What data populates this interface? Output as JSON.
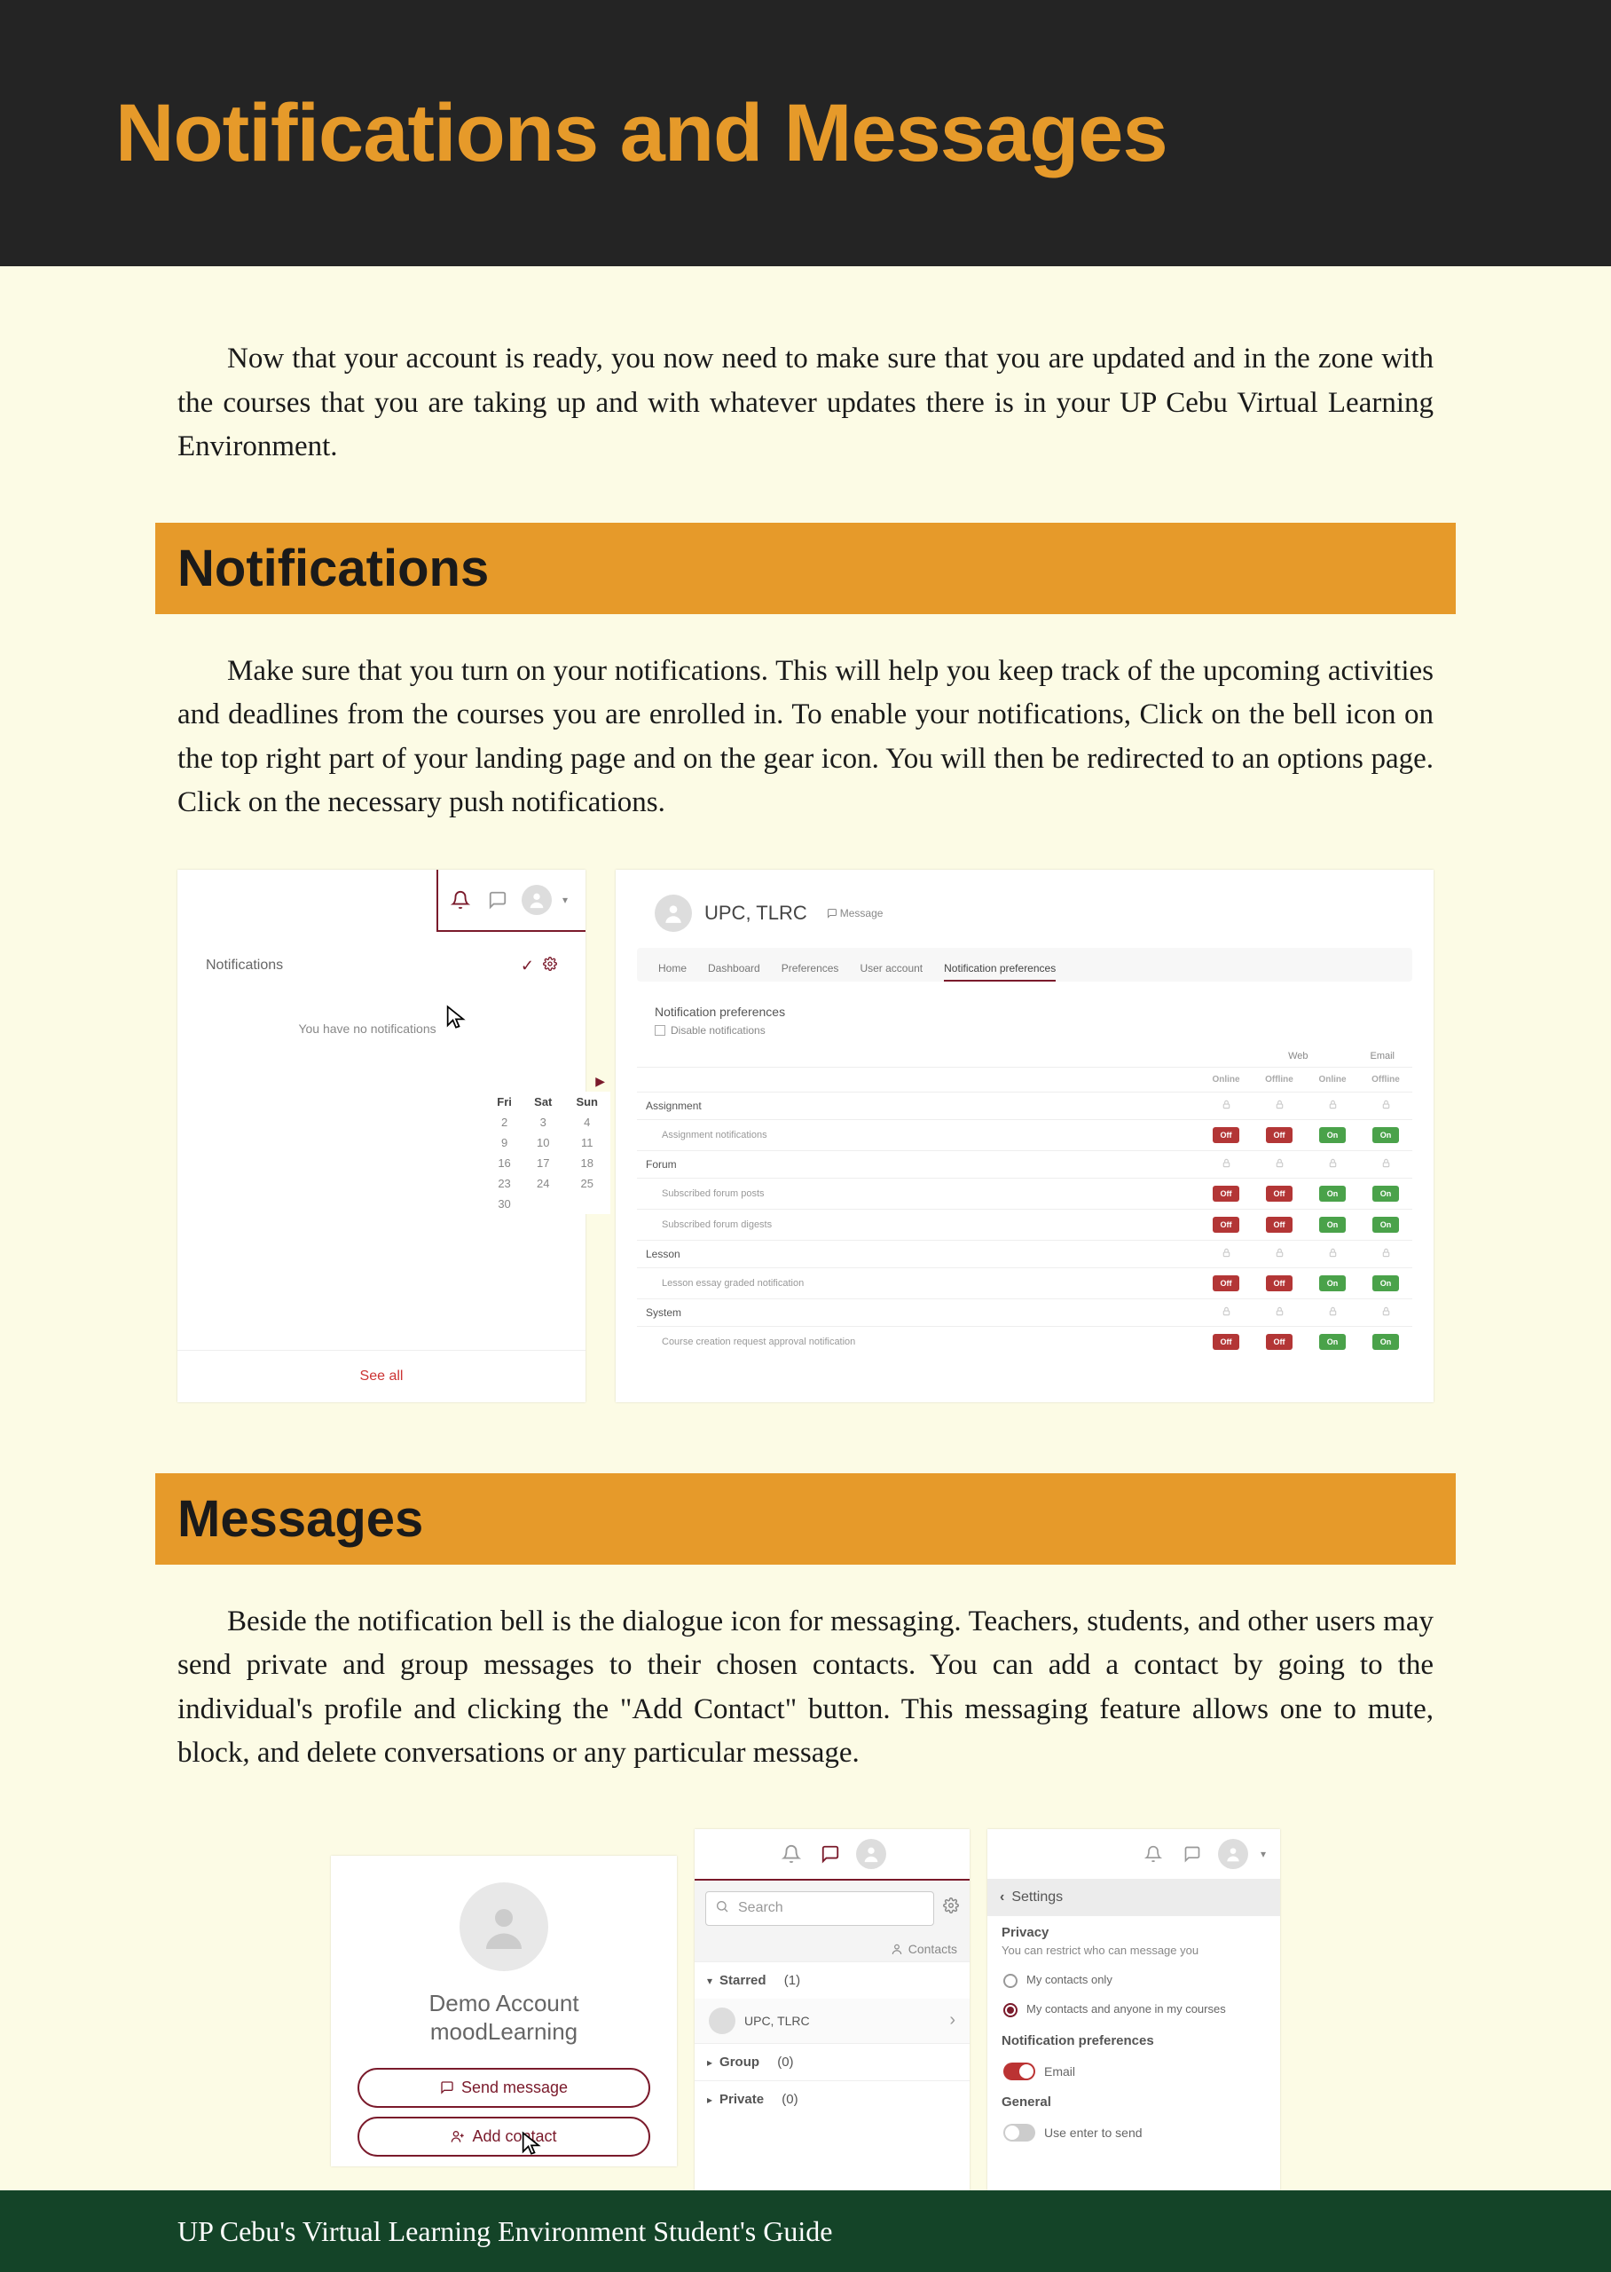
{
  "header": {
    "title": "Notifications and Messages"
  },
  "intro": "Now that your account is ready, you now need to make sure that you are updated and in the zone with the courses that you are taking up and with whatever updates there is in your UP Cebu Virtual Learning Environment.",
  "sections": {
    "notifications": {
      "heading": "Notifications",
      "body": "Make sure that you turn on your notifications. This will help you keep track of the upcoming activities and deadlines from the courses you are enrolled in. To enable your notifications, Click on the bell icon on the top right part of your landing page and on the gear icon. You will then be redirected to an options page. Click on the necessary push notifications."
    },
    "messages": {
      "heading": "Messages",
      "body": "Beside the notification bell is the dialogue icon for messaging. Teachers, students, and other users may send private and group messages to their chosen contacts. You can add a contact by going to the individual's profile and clicking the \"Add Contact\" button. This messaging feature allows one to mute, block, and delete conversations or any particular message."
    }
  },
  "notif_panel": {
    "title": "Notifications",
    "empty": "You have no notifications",
    "see_all": "See all",
    "cal_head": [
      "Fri",
      "Sat",
      "Sun"
    ],
    "cal_rows": [
      [
        "2",
        "3",
        "4"
      ],
      [
        "9",
        "10",
        "11"
      ],
      [
        "16",
        "17",
        "18"
      ],
      [
        "23",
        "24",
        "25"
      ],
      [
        "30",
        "",
        ""
      ]
    ]
  },
  "pref_panel": {
    "user": "UPC, TLRC",
    "message_link": "Message",
    "tabs": [
      "Home",
      "Dashboard",
      "Preferences",
      "User account",
      "Notification preferences"
    ],
    "title": "Notification preferences",
    "disable": "Disable notifications",
    "cols_group": [
      "Web",
      "Email"
    ],
    "cols": [
      "Online",
      "Offline",
      "Online",
      "Offline"
    ],
    "rows": [
      {
        "type": "cat",
        "label": "Assignment",
        "badges": [
          "",
          "",
          "",
          ""
        ]
      },
      {
        "type": "sub",
        "label": "Assignment notifications",
        "badges": [
          "off",
          "off",
          "on",
          "on"
        ]
      },
      {
        "type": "cat",
        "label": "Forum",
        "badges": [
          "",
          "",
          "",
          ""
        ]
      },
      {
        "type": "sub",
        "label": "Subscribed forum posts",
        "badges": [
          "off",
          "off",
          "on",
          "on"
        ]
      },
      {
        "type": "sub",
        "label": "Subscribed forum digests",
        "badges": [
          "off",
          "off",
          "on",
          "on"
        ]
      },
      {
        "type": "cat",
        "label": "Lesson",
        "badges": [
          "",
          "",
          "",
          ""
        ]
      },
      {
        "type": "sub",
        "label": "Lesson essay graded notification",
        "badges": [
          "off",
          "off",
          "on",
          "on"
        ]
      },
      {
        "type": "cat",
        "label": "System",
        "badges": [
          "",
          "",
          "",
          ""
        ]
      },
      {
        "type": "sub",
        "label": "Course creation request approval notification",
        "badges": [
          "off",
          "off",
          "on",
          "on"
        ]
      }
    ]
  },
  "msg_profile": {
    "name_line1": "Demo Account",
    "name_line2": "moodLearning",
    "send_msg": "Send message",
    "add_contact": "Add contact"
  },
  "msg_panel": {
    "search": "Search",
    "contacts": "Contacts",
    "starred": "Starred",
    "starred_count": "(1)",
    "starred_item": "UPC, TLRC",
    "group": "Group",
    "group_count": "(0)",
    "private": "Private",
    "private_count": "(0)"
  },
  "msg_settings": {
    "back": "Settings",
    "privacy_head": "Privacy",
    "privacy_sub": "You can restrict who can message you",
    "opt1": "My contacts only",
    "opt2": "My contacts and anyone in my courses",
    "notif_head": "Notification preferences",
    "email": "Email",
    "general_head": "General",
    "enter_send": "Use enter to send"
  },
  "footer": "UP Cebu's Virtual Learning Environment Student's Guide"
}
